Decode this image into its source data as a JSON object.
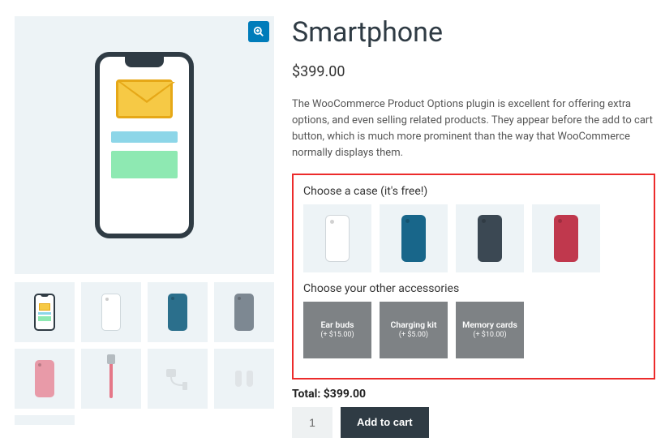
{
  "product": {
    "title": "Smartphone",
    "price_display": "$399.00",
    "description": "The WooCommerce Product Options plugin is excellent for offering extra options, and even selling related products. They appear before the add to cart button, which is much more prominent than the way that WooCommerce normally displays them."
  },
  "gallery": {
    "zoom_icon": "search-plus-icon",
    "thumbs": [
      {
        "kind": "phone-preview"
      },
      {
        "kind": "case-white"
      },
      {
        "kind": "case-blue"
      },
      {
        "kind": "case-grey"
      },
      {
        "kind": "case-pink"
      },
      {
        "kind": "selfie-stick"
      },
      {
        "kind": "charging-kit"
      },
      {
        "kind": "earbuds"
      }
    ]
  },
  "options": {
    "case_label": "Choose a case (it's free!)",
    "cases": [
      {
        "color_name": "white"
      },
      {
        "color_name": "blue"
      },
      {
        "color_name": "dark"
      },
      {
        "color_name": "red"
      }
    ],
    "accessories_label": "Choose your other accessories",
    "accessories": [
      {
        "name": "Ear buds",
        "price_display": "(+ $15.00)",
        "price": 15.0
      },
      {
        "name": "Charging kit",
        "price_display": "(+ $5.00)",
        "price": 5.0
      },
      {
        "name": "Memory cards",
        "price_display": "(+ $10.00)",
        "price": 10.0
      }
    ]
  },
  "cart": {
    "total_label": "Total:",
    "total_display": "$399.00",
    "quantity": "1",
    "add_label": "Add to cart"
  }
}
